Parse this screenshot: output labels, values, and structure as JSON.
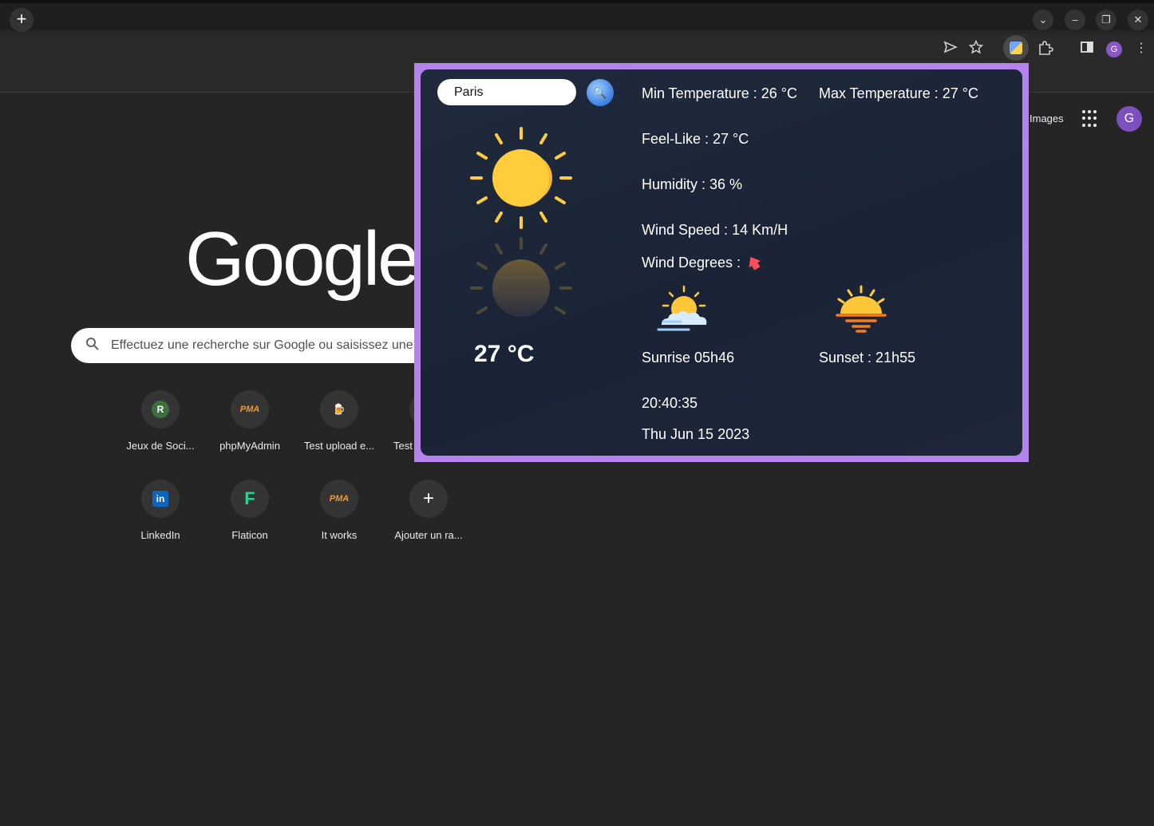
{
  "browser": {
    "new_tab_symbol": "+",
    "window_buttons": [
      "⌄",
      "–",
      "❐",
      "✕"
    ],
    "avatar_letter": "G"
  },
  "ntp": {
    "logo_text": "Google",
    "images_link": "Images",
    "avatar_letter": "G",
    "search_placeholder": "Effectuez une recherche sur Google ou saisissez une URL",
    "shortcuts": [
      {
        "label": "Jeux de Soci...",
        "icon_text": "R"
      },
      {
        "label": "phpMyAdmin",
        "icon_text": "PMA"
      },
      {
        "label": "Test upload e...",
        "icon_text": "🍺"
      },
      {
        "label": "Test",
        "icon_text": ""
      },
      {
        "label": "LinkedIn",
        "icon_text": "in"
      },
      {
        "label": "Flaticon",
        "icon_text": "F"
      },
      {
        "label": "It works",
        "icon_text": "PMA"
      },
      {
        "label": "Ajouter un ra...",
        "icon_text": "+"
      }
    ]
  },
  "weather": {
    "city_value": "Paris",
    "search_symbol": "🔍",
    "temperature": "27 °C",
    "min_temp": "Min Temperature : 26 °C",
    "max_temp": "Max Temperature : 27 °C",
    "feels_like": "Feel-Like : 27 °C",
    "humidity": "Humidity : 36 %",
    "wind_speed": "Wind Speed : 14 Km/H",
    "wind_degrees": "Wind Degrees :",
    "wind_arrow": "🡅",
    "sunrise": "Sunrise 05h46",
    "sunset": "Sunset : 21h55",
    "time": "20:40:35",
    "date": "Thu Jun 15 2023",
    "colors": {
      "popup_border": "#b583ec",
      "sun": "#ffcd3c",
      "wind_arrow": "#ff4d5a"
    }
  }
}
